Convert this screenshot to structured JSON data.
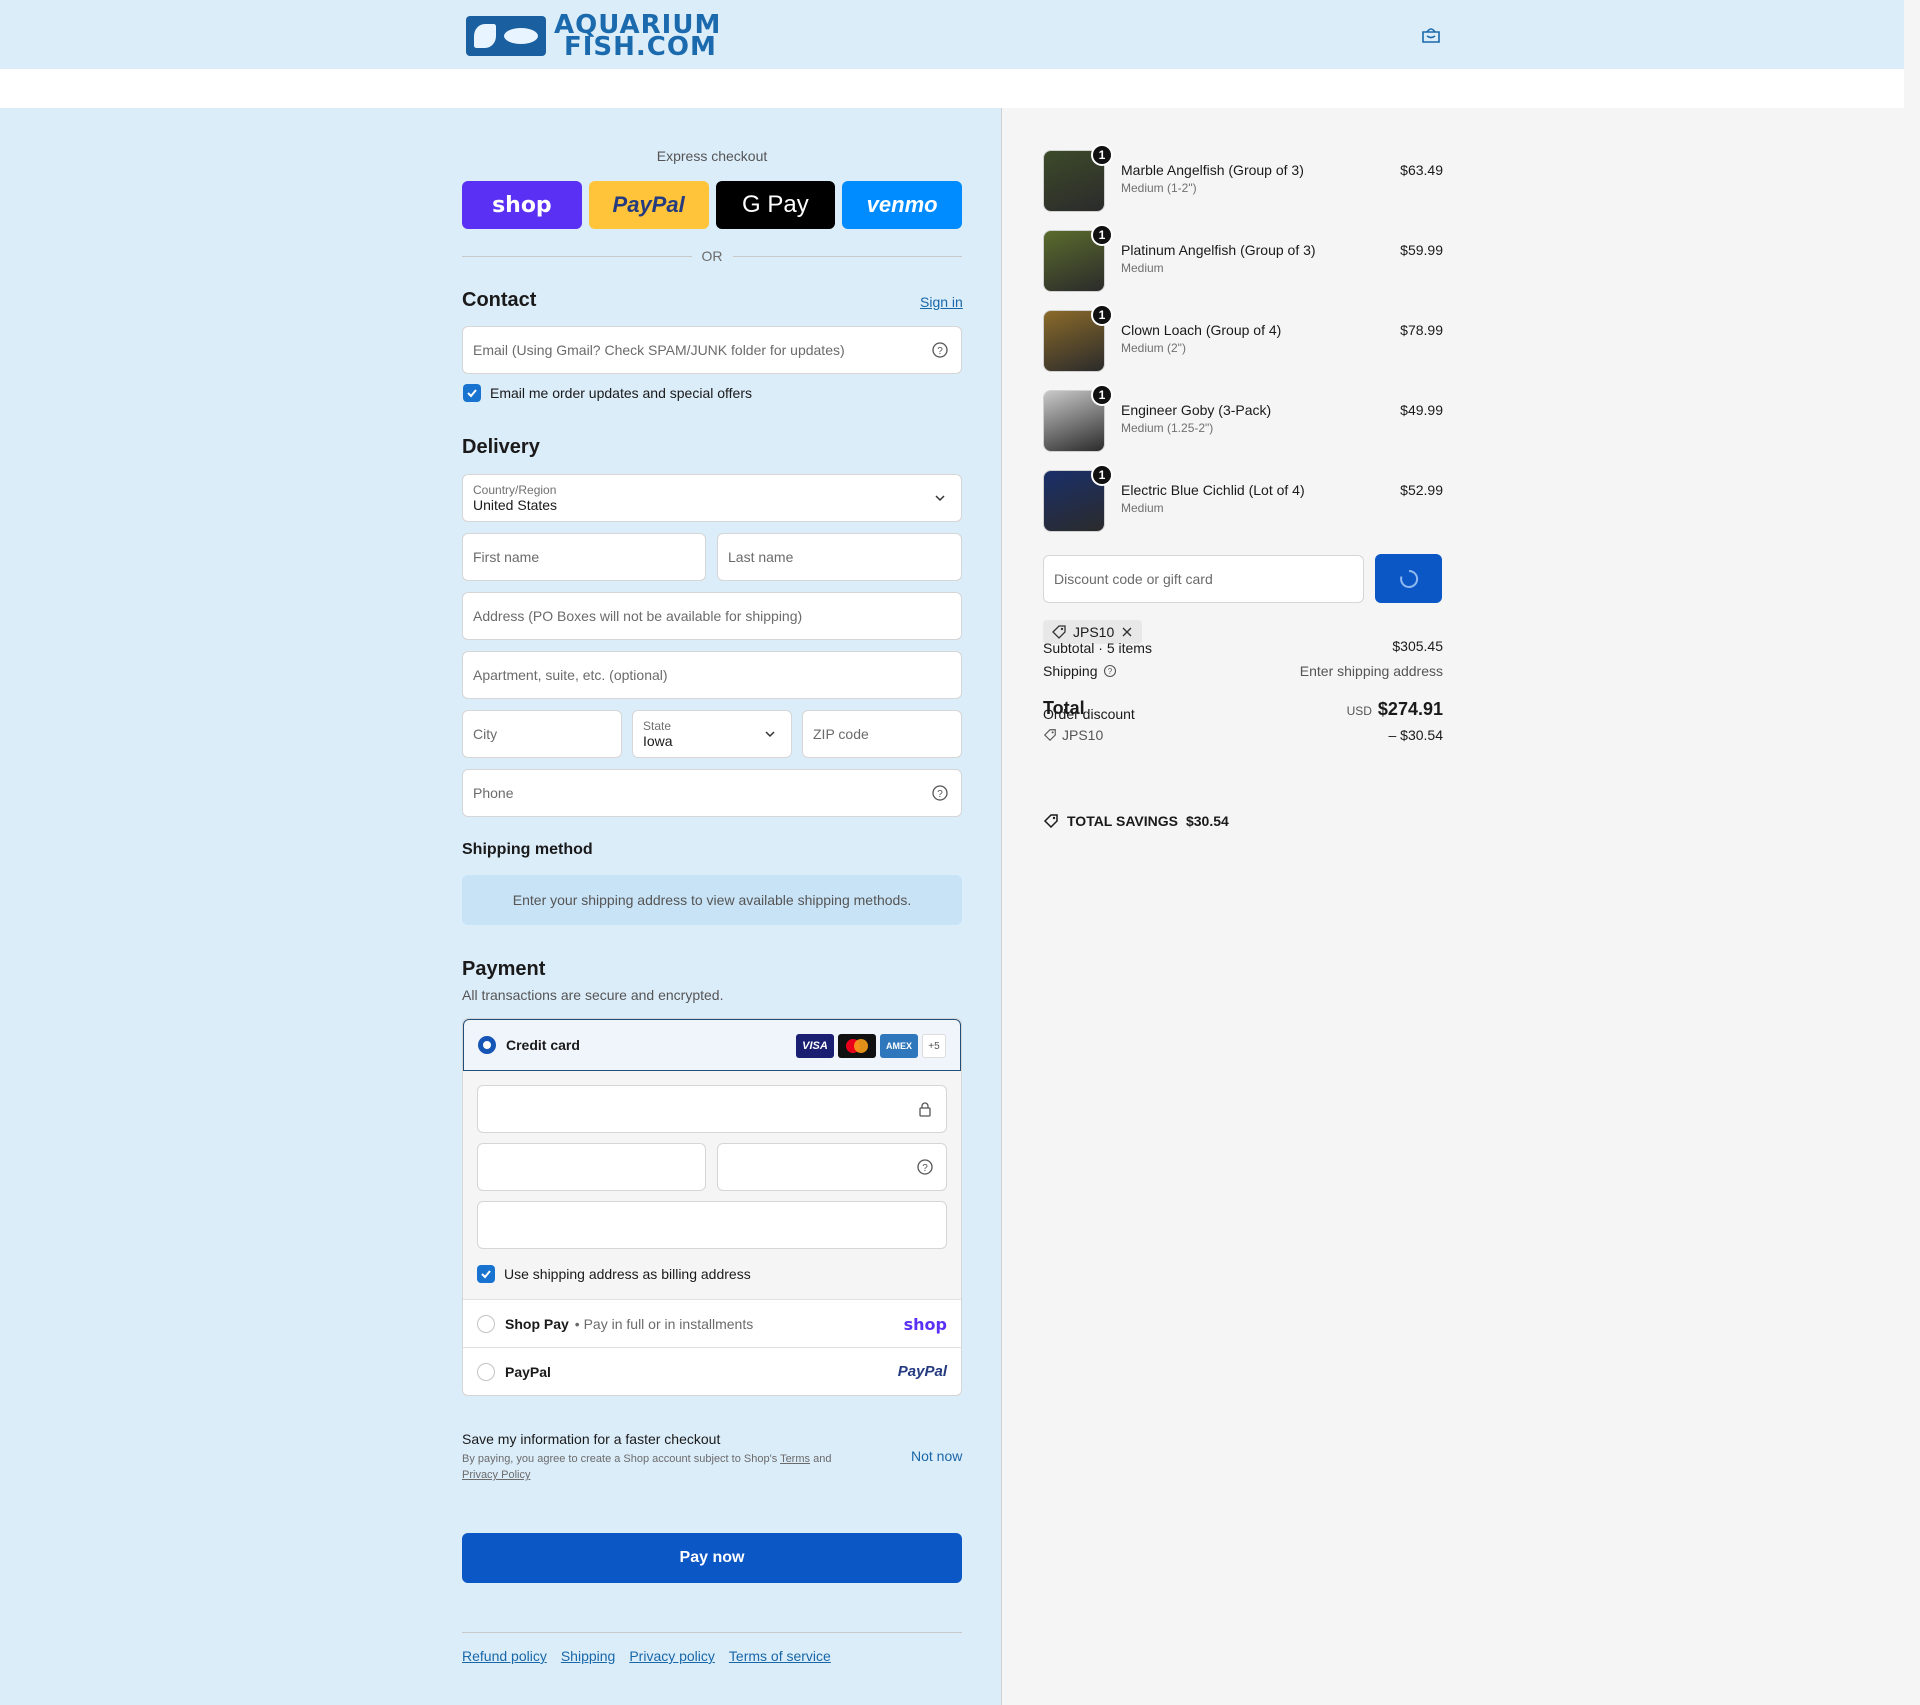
{
  "header": {
    "logo_line1": "AQUARIUM",
    "logo_line2": "FISH.COM"
  },
  "express": {
    "title": "Express checkout",
    "shop": "shop",
    "paypal": "PayPal",
    "gpay": "G Pay",
    "venmo": "venmo",
    "or": "OR"
  },
  "contact": {
    "heading": "Contact",
    "sign_in": "Sign in",
    "email_placeholder": "Email (Using Gmail? Check SPAM/JUNK folder for updates)",
    "email_updates": "Email me order updates and special offers"
  },
  "delivery": {
    "heading": "Delivery",
    "country_label": "Country/Region",
    "country_value": "United States",
    "first_name": "First name",
    "last_name": "Last name",
    "address": "Address (PO Boxes will not be available for shipping)",
    "apartment": "Apartment, suite, etc. (optional)",
    "city": "City",
    "state_label": "State",
    "state_value": "Iowa",
    "zip": "ZIP code",
    "phone": "Phone"
  },
  "shipping_method": {
    "heading": "Shipping method",
    "message": "Enter your shipping address to view available shipping methods."
  },
  "payment": {
    "heading": "Payment",
    "subtitle": "All transactions are secure and encrypted.",
    "credit_card": "Credit card",
    "card_visa": "VISA",
    "card_amex": "AMEX",
    "card_more": "+5",
    "billing_same": "Use shipping address as billing address",
    "shop_pay": "Shop Pay",
    "shop_pay_hint": "• Pay in full or in installments",
    "shop_brand": "shop",
    "paypal": "PayPal",
    "paypal_brand": "PayPal"
  },
  "save_info": {
    "title": "Save my information for a faster checkout",
    "text_prefix": "By paying, you agree to create a Shop account subject to Shop's",
    "terms": "Terms",
    "and": "and",
    "privacy": "Privacy Policy",
    "not_now": "Not now"
  },
  "pay_now": "Pay now",
  "footer": {
    "links": [
      "Refund policy",
      "Shipping",
      "Privacy policy",
      "Terms of service"
    ]
  },
  "cart": {
    "items": [
      {
        "name": "Marble Angelfish (Group of 3)",
        "variant": "Medium (1-2\")",
        "price": "$63.49",
        "qty": "1",
        "color": "#3d4a2a"
      },
      {
        "name": "Platinum Angelfish (Group of 3)",
        "variant": "Medium",
        "price": "$59.99",
        "qty": "1",
        "color": "#5a6b2c"
      },
      {
        "name": "Clown Loach (Group of 4)",
        "variant": "Medium (2\")",
        "price": "$78.99",
        "qty": "1",
        "color": "#8a6a2a"
      },
      {
        "name": "Engineer Goby (3-Pack)",
        "variant": "Medium (1.25-2\")",
        "price": "$49.99",
        "qty": "1",
        "color": "#c9c9c9"
      },
      {
        "name": "Electric Blue Cichlid (Lot of 4)",
        "variant": "Medium",
        "price": "$52.99",
        "qty": "1",
        "color": "#1a2f6a"
      }
    ],
    "discount_placeholder": "Discount code or gift card",
    "applied_code": "JPS10",
    "subtotal_label": "Subtotal · 5 items",
    "subtotal_value": "$305.45",
    "shipping_label": "Shipping",
    "shipping_value": "Enter shipping address",
    "order_discount_label": "Order discount",
    "discount_code": "JPS10",
    "discount_value": "– $30.54",
    "total_label": "Total",
    "currency": "USD",
    "total_value": "$274.91",
    "savings_label": "TOTAL SAVINGS",
    "savings_value": "$30.54"
  }
}
